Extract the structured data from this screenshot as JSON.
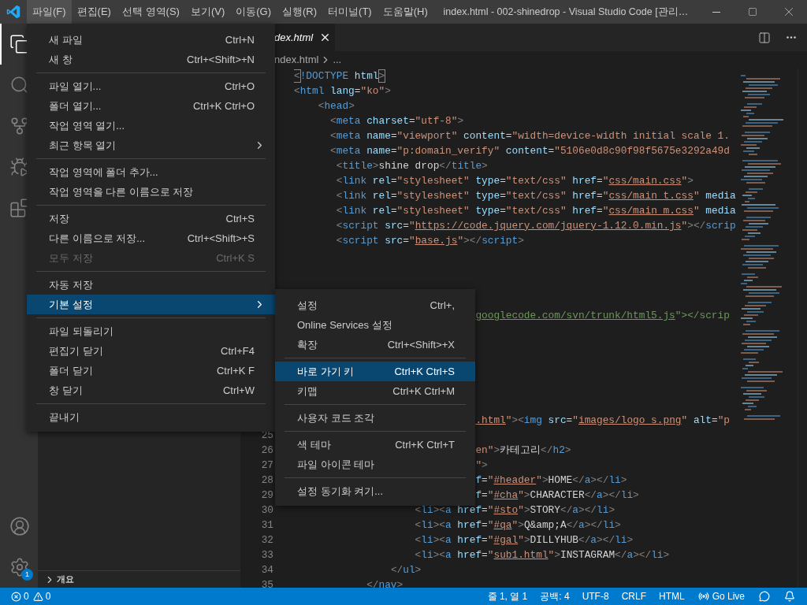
{
  "title_bar": {
    "menus": [
      {
        "label": "파일(F)",
        "selected": true
      },
      {
        "label": "편집(E)",
        "selected": false
      },
      {
        "label": "선택 영역(S)",
        "selected": false
      },
      {
        "label": "보기(V)",
        "selected": false
      },
      {
        "label": "이동(G)",
        "selected": false
      },
      {
        "label": "실행(R)",
        "selected": false
      },
      {
        "label": "터미널(T)",
        "selected": false
      },
      {
        "label": "도움말(H)",
        "selected": false
      }
    ],
    "title": "index.html - 002-shinedrop - Visual Studio Code [관리…"
  },
  "activity_bar": {
    "items": [
      {
        "kind": "files",
        "selected": true
      },
      {
        "kind": "search",
        "selected": false
      },
      {
        "kind": "source-control",
        "selected": false
      },
      {
        "kind": "run",
        "selected": false
      },
      {
        "kind": "extensions",
        "selected": false
      }
    ],
    "bottom": [
      {
        "kind": "account"
      },
      {
        "kind": "settings",
        "badge": "1"
      }
    ]
  },
  "sidebar": {
    "section": "개요"
  },
  "editor": {
    "tab": {
      "label": "dex.html"
    },
    "breadcrumb": {
      "file": "ndex.html",
      "more": "..."
    },
    "lines": [
      {
        "tokens": [
          {
            "kind": "match",
            "text": "<"
          },
          {
            "kind": "tag",
            "text": "!DOCTYPE"
          },
          {
            "kind": "attr",
            "text": " html"
          },
          {
            "kind": "match",
            "text": ">"
          }
        ]
      },
      {
        "tokens": [
          {
            "kind": "p",
            "text": "<"
          },
          {
            "kind": "tag",
            "text": "html"
          },
          {
            "kind": "attr",
            "text": " lang"
          },
          {
            "kind": "eq",
            "text": "="
          },
          {
            "kind": "str",
            "text": "\"ko\""
          },
          {
            "kind": "p",
            "text": ">"
          }
        ]
      },
      {
        "tokens": [
          {
            "kind": "p",
            "text": "    <"
          },
          {
            "kind": "tag",
            "text": "head"
          },
          {
            "kind": "p",
            "text": ">"
          }
        ]
      },
      {
        "tokens": [
          {
            "kind": "p",
            "text": "      <"
          },
          {
            "kind": "tag",
            "text": "meta"
          },
          {
            "kind": "attr",
            "text": " charset"
          },
          {
            "kind": "eq",
            "text": "="
          },
          {
            "kind": "str",
            "text": "\"utf-8\""
          },
          {
            "kind": "p",
            "text": ">"
          }
        ]
      },
      {
        "tokens": [
          {
            "kind": "p",
            "text": "      <"
          },
          {
            "kind": "tag",
            "text": "meta"
          },
          {
            "kind": "attr",
            "text": " name"
          },
          {
            "kind": "eq",
            "text": "="
          },
          {
            "kind": "str",
            "text": "\"viewport\""
          },
          {
            "kind": "attr",
            "text": " content"
          },
          {
            "kind": "eq",
            "text": "="
          },
          {
            "kind": "str",
            "text": "\"width=device-width initial scale 1."
          }
        ]
      },
      {
        "tokens": [
          {
            "kind": "p",
            "text": "      <"
          },
          {
            "kind": "tag",
            "text": "meta"
          },
          {
            "kind": "attr",
            "text": " name"
          },
          {
            "kind": "eq",
            "text": "="
          },
          {
            "kind": "str",
            "text": "\"p:domain_verify\""
          },
          {
            "kind": "attr",
            "text": " content"
          },
          {
            "kind": "eq",
            "text": "="
          },
          {
            "kind": "str",
            "text": "\"5106e0d8c90f98f5675e3292a49d"
          }
        ]
      },
      {
        "tokens": [
          {
            "kind": "p",
            "text": "       <"
          },
          {
            "kind": "tag",
            "text": "title"
          },
          {
            "kind": "p",
            "text": ">"
          },
          {
            "kind": "text",
            "text": "shine drop"
          },
          {
            "kind": "p",
            "text": "</"
          },
          {
            "kind": "tag",
            "text": "title"
          },
          {
            "kind": "p",
            "text": ">"
          }
        ]
      },
      {
        "tokens": [
          {
            "kind": "p",
            "text": "       <"
          },
          {
            "kind": "tag",
            "text": "link"
          },
          {
            "kind": "attr",
            "text": " rel"
          },
          {
            "kind": "eq",
            "text": "="
          },
          {
            "kind": "str",
            "text": "\"stylesheet\""
          },
          {
            "kind": "attr",
            "text": " type"
          },
          {
            "kind": "eq",
            "text": "="
          },
          {
            "kind": "str",
            "text": "\"text/css\""
          },
          {
            "kind": "attr",
            "text": " href"
          },
          {
            "kind": "eq",
            "text": "="
          },
          {
            "kind": "str",
            "text": "\""
          },
          {
            "kind": "link",
            "text": "css/main.css"
          },
          {
            "kind": "str",
            "text": "\""
          },
          {
            "kind": "p",
            "text": ">"
          }
        ]
      },
      {
        "tokens": [
          {
            "kind": "p",
            "text": "       <"
          },
          {
            "kind": "tag",
            "text": "link"
          },
          {
            "kind": "attr",
            "text": " rel"
          },
          {
            "kind": "eq",
            "text": "="
          },
          {
            "kind": "str",
            "text": "\"stylesheet\""
          },
          {
            "kind": "attr",
            "text": " type"
          },
          {
            "kind": "eq",
            "text": "="
          },
          {
            "kind": "str",
            "text": "\"text/css\""
          },
          {
            "kind": "attr",
            "text": " href"
          },
          {
            "kind": "eq",
            "text": "="
          },
          {
            "kind": "str",
            "text": "\""
          },
          {
            "kind": "link",
            "text": "css/main_t.css"
          },
          {
            "kind": "str",
            "text": "\""
          },
          {
            "kind": "attr",
            "text": " media"
          }
        ]
      },
      {
        "tokens": [
          {
            "kind": "p",
            "text": "       <"
          },
          {
            "kind": "tag",
            "text": "link"
          },
          {
            "kind": "attr",
            "text": " rel"
          },
          {
            "kind": "eq",
            "text": "="
          },
          {
            "kind": "str",
            "text": "\"stylesheet\""
          },
          {
            "kind": "attr",
            "text": " type"
          },
          {
            "kind": "eq",
            "text": "="
          },
          {
            "kind": "str",
            "text": "\"text/css\""
          },
          {
            "kind": "attr",
            "text": " href"
          },
          {
            "kind": "eq",
            "text": "="
          },
          {
            "kind": "str",
            "text": "\""
          },
          {
            "kind": "link",
            "text": "css/main_m.css"
          },
          {
            "kind": "str",
            "text": "\""
          },
          {
            "kind": "attr",
            "text": " media"
          }
        ]
      },
      {
        "tokens": [
          {
            "kind": "p",
            "text": "       <"
          },
          {
            "kind": "tag",
            "text": "script"
          },
          {
            "kind": "attr",
            "text": " src"
          },
          {
            "kind": "eq",
            "text": "="
          },
          {
            "kind": "str",
            "text": "\""
          },
          {
            "kind": "link",
            "text": "https://code.jquery.com/jquery-1.12.0.min.js"
          },
          {
            "kind": "str",
            "text": "\""
          },
          {
            "kind": "p",
            "text": "></"
          },
          {
            "kind": "tag",
            "text": "scrip"
          }
        ]
      },
      {
        "tokens": [
          {
            "kind": "p",
            "text": "       <"
          },
          {
            "kind": "tag",
            "text": "script"
          },
          {
            "kind": "attr",
            "text": " src"
          },
          {
            "kind": "eq",
            "text": "="
          },
          {
            "kind": "str",
            "text": "\""
          },
          {
            "kind": "link",
            "text": "base.js"
          },
          {
            "kind": "str",
            "text": "\""
          },
          {
            "kind": "p",
            "text": "></"
          },
          {
            "kind": "tag",
            "text": "script"
          },
          {
            "kind": "p",
            "text": ">"
          }
        ]
      },
      {
        "kind": "blank"
      },
      {
        "kind": "blank"
      },
      {
        "kind": "blank"
      },
      {
        "kind": "blank"
      },
      {
        "kind": "clipped",
        "tokens": [
          {
            "kind": "clink",
            "text": "googlecode.com/svn/trunk/html5.js"
          },
          {
            "kind": "comment",
            "text": "\"></scrip"
          }
        ]
      },
      {
        "kind": "blank"
      },
      {
        "kind": "blank"
      },
      {
        "kind": "blank"
      },
      {
        "kind": "blank"
      },
      {
        "kind": "blank"
      },
      {
        "kind": "blank"
      },
      {
        "kind": "clipped",
        "tokens": [
          {
            "kind": "link",
            "text": ".html"
          },
          {
            "kind": "str",
            "text": "\""
          },
          {
            "kind": "p",
            "text": "><"
          },
          {
            "kind": "tag",
            "text": "img"
          },
          {
            "kind": "attr",
            "text": " src"
          },
          {
            "kind": "eq",
            "text": "="
          },
          {
            "kind": "str",
            "text": "\""
          },
          {
            "kind": "link",
            "text": "images/logo_s.png"
          },
          {
            "kind": "str",
            "text": "\""
          },
          {
            "kind": "attr",
            "text": " alt"
          },
          {
            "kind": "eq",
            "text": "="
          },
          {
            "kind": "str",
            "text": "\"p"
          }
        ]
      },
      {
        "number": "25",
        "kind": "blank"
      },
      {
        "number": "26",
        "kind": "clipped",
        "tokens": [
          {
            "kind": "str",
            "text": "en\""
          },
          {
            "kind": "p",
            "text": ">"
          },
          {
            "kind": "text",
            "text": "카테고리"
          },
          {
            "kind": "p",
            "text": "</"
          },
          {
            "kind": "tag",
            "text": "h2"
          },
          {
            "kind": "p",
            "text": ">"
          }
        ]
      },
      {
        "number": "27",
        "kind": "clipped",
        "tokens": [
          {
            "kind": "str",
            "text": "\""
          },
          {
            "kind": "p",
            "text": ">"
          }
        ]
      },
      {
        "number": "28",
        "kind": "clipped",
        "tokens": [
          {
            "kind": "attr",
            "text": "f"
          },
          {
            "kind": "eq",
            "text": "="
          },
          {
            "kind": "str",
            "text": "\""
          },
          {
            "kind": "link",
            "text": "#header"
          },
          {
            "kind": "str",
            "text": "\""
          },
          {
            "kind": "p",
            "text": ">"
          },
          {
            "kind": "text",
            "text": "HOME"
          },
          {
            "kind": "p",
            "text": "</"
          },
          {
            "kind": "tag",
            "text": "a"
          },
          {
            "kind": "p",
            "text": "></"
          },
          {
            "kind": "tag",
            "text": "li"
          },
          {
            "kind": "p",
            "text": ">"
          }
        ]
      },
      {
        "number": "29",
        "kind": "clipped",
        "tokens": [
          {
            "kind": "attr",
            "text": "f"
          },
          {
            "kind": "eq",
            "text": "="
          },
          {
            "kind": "str",
            "text": "\""
          },
          {
            "kind": "link",
            "text": "#cha"
          },
          {
            "kind": "str",
            "text": "\""
          },
          {
            "kind": "p",
            "text": ">"
          },
          {
            "kind": "text",
            "text": "CHARACTER"
          },
          {
            "kind": "p",
            "text": "</"
          },
          {
            "kind": "tag",
            "text": "a"
          },
          {
            "kind": "p",
            "text": "></"
          },
          {
            "kind": "tag",
            "text": "li"
          },
          {
            "kind": "p",
            "text": ">"
          }
        ]
      },
      {
        "number": "30",
        "tokens": [
          {
            "kind": "p",
            "text": "                    <"
          },
          {
            "kind": "tag",
            "text": "li"
          },
          {
            "kind": "p",
            "text": "><"
          },
          {
            "kind": "tag",
            "text": "a"
          },
          {
            "kind": "attr",
            "text": " href"
          },
          {
            "kind": "eq",
            "text": "="
          },
          {
            "kind": "str",
            "text": "\""
          },
          {
            "kind": "link",
            "text": "#sto"
          },
          {
            "kind": "str",
            "text": "\""
          },
          {
            "kind": "p",
            "text": ">"
          },
          {
            "kind": "text",
            "text": "STORY"
          },
          {
            "kind": "p",
            "text": "</"
          },
          {
            "kind": "tag",
            "text": "a"
          },
          {
            "kind": "p",
            "text": "></"
          },
          {
            "kind": "tag",
            "text": "li"
          },
          {
            "kind": "p",
            "text": ">"
          }
        ]
      },
      {
        "number": "31",
        "tokens": [
          {
            "kind": "p",
            "text": "                    <"
          },
          {
            "kind": "tag",
            "text": "li"
          },
          {
            "kind": "p",
            "text": "><"
          },
          {
            "kind": "tag",
            "text": "a"
          },
          {
            "kind": "attr",
            "text": " href"
          },
          {
            "kind": "eq",
            "text": "="
          },
          {
            "kind": "str",
            "text": "\""
          },
          {
            "kind": "link",
            "text": "#qa"
          },
          {
            "kind": "str",
            "text": "\""
          },
          {
            "kind": "p",
            "text": ">"
          },
          {
            "kind": "text",
            "text": "Q&amp;A"
          },
          {
            "kind": "p",
            "text": "</"
          },
          {
            "kind": "tag",
            "text": "a"
          },
          {
            "kind": "p",
            "text": "></"
          },
          {
            "kind": "tag",
            "text": "li"
          },
          {
            "kind": "p",
            "text": ">"
          }
        ]
      },
      {
        "number": "32",
        "tokens": [
          {
            "kind": "p",
            "text": "                    <"
          },
          {
            "kind": "tag",
            "text": "li"
          },
          {
            "kind": "p",
            "text": "><"
          },
          {
            "kind": "tag",
            "text": "a"
          },
          {
            "kind": "attr",
            "text": " href"
          },
          {
            "kind": "eq",
            "text": "="
          },
          {
            "kind": "str",
            "text": "\""
          },
          {
            "kind": "link",
            "text": "#gal"
          },
          {
            "kind": "str",
            "text": "\""
          },
          {
            "kind": "p",
            "text": ">"
          },
          {
            "kind": "text",
            "text": "DILLYHUB"
          },
          {
            "kind": "p",
            "text": "</"
          },
          {
            "kind": "tag",
            "text": "a"
          },
          {
            "kind": "p",
            "text": "></"
          },
          {
            "kind": "tag",
            "text": "li"
          },
          {
            "kind": "p",
            "text": ">"
          }
        ]
      },
      {
        "number": "33",
        "tokens": [
          {
            "kind": "p",
            "text": "                    <"
          },
          {
            "kind": "tag",
            "text": "li"
          },
          {
            "kind": "p",
            "text": "><"
          },
          {
            "kind": "tag",
            "text": "a"
          },
          {
            "kind": "attr",
            "text": " href"
          },
          {
            "kind": "eq",
            "text": "="
          },
          {
            "kind": "str",
            "text": "\""
          },
          {
            "kind": "link",
            "text": "sub1.html"
          },
          {
            "kind": "str",
            "text": "\""
          },
          {
            "kind": "p",
            "text": ">"
          },
          {
            "kind": "text",
            "text": "INSTAGRAM"
          },
          {
            "kind": "p",
            "text": "</"
          },
          {
            "kind": "tag",
            "text": "a"
          },
          {
            "kind": "p",
            "text": "></"
          },
          {
            "kind": "tag",
            "text": "li"
          },
          {
            "kind": "p",
            "text": ">"
          }
        ]
      },
      {
        "number": "34",
        "tokens": [
          {
            "kind": "p",
            "text": "                </"
          },
          {
            "kind": "tag",
            "text": "ul"
          },
          {
            "kind": "p",
            "text": ">"
          }
        ]
      },
      {
        "number": "35",
        "tokens": [
          {
            "kind": "p",
            "text": "            </"
          },
          {
            "kind": "tag",
            "text": "nav"
          },
          {
            "kind": "p",
            "text": ">"
          }
        ]
      }
    ]
  },
  "file_menu": {
    "items": [
      {
        "kind": "item",
        "label": "새 파일",
        "shortcut": "Ctrl+N",
        "selected": false,
        "disabled": false
      },
      {
        "kind": "item",
        "label": "새 창",
        "shortcut": "Ctrl+<Shift>+N",
        "selected": false,
        "disabled": false
      },
      {
        "kind": "separator"
      },
      {
        "kind": "item",
        "label": "파일 열기...",
        "shortcut": "Ctrl+O",
        "selected": false,
        "disabled": false
      },
      {
        "kind": "item",
        "label": "폴더 열기...",
        "shortcut": "Ctrl+K Ctrl+O",
        "selected": false,
        "disabled": false
      },
      {
        "kind": "item",
        "label": "작업 영역 열기...",
        "selected": false,
        "disabled": false
      },
      {
        "kind": "item",
        "label": "최근 항목 열기",
        "submenu": true,
        "selected": false,
        "disabled": false
      },
      {
        "kind": "separator"
      },
      {
        "kind": "item",
        "label": "작업 영역에 폴더 추가...",
        "selected": false,
        "disabled": false
      },
      {
        "kind": "item",
        "label": "작업 영역을 다른 이름으로 저장",
        "selected": false,
        "disabled": false
      },
      {
        "kind": "separator"
      },
      {
        "kind": "item",
        "label": "저장",
        "shortcut": "Ctrl+S",
        "selected": false,
        "disabled": false
      },
      {
        "kind": "item",
        "label": "다른 이름으로 저장...",
        "shortcut": "Ctrl+<Shift>+S",
        "selected": false,
        "disabled": false
      },
      {
        "kind": "item",
        "label": "모두 저장",
        "shortcut": "Ctrl+K S",
        "selected": false,
        "disabled": true
      },
      {
        "kind": "separator"
      },
      {
        "kind": "item",
        "label": "자동 저장",
        "selected": false,
        "disabled": false
      },
      {
        "kind": "item",
        "label": "기본 설정",
        "submenu": true,
        "selected": true,
        "disabled": false
      },
      {
        "kind": "separator"
      },
      {
        "kind": "item",
        "label": "파일 되돌리기",
        "selected": false,
        "disabled": false
      },
      {
        "kind": "item",
        "label": "편집기 닫기",
        "shortcut": "Ctrl+F4",
        "selected": false,
        "disabled": false
      },
      {
        "kind": "item",
        "label": "폴더 닫기",
        "shortcut": "Ctrl+K F",
        "selected": false,
        "disabled": false
      },
      {
        "kind": "item",
        "label": "창 닫기",
        "shortcut": "Ctrl+W",
        "selected": false,
        "disabled": false
      },
      {
        "kind": "separator"
      },
      {
        "kind": "item",
        "label": "끝내기",
        "selected": false,
        "disabled": false
      }
    ]
  },
  "preferences_menu": {
    "items": [
      {
        "kind": "item",
        "label": "설정",
        "shortcut": "Ctrl+,",
        "selected": false,
        "disabled": false
      },
      {
        "kind": "item",
        "label": "Online Services 설정",
        "selected": false,
        "disabled": false
      },
      {
        "kind": "item",
        "label": "확장",
        "shortcut": "Ctrl+<Shift>+X",
        "selected": false,
        "disabled": false
      },
      {
        "kind": "separator"
      },
      {
        "kind": "item",
        "label": "바로 가기 키",
        "shortcut": "Ctrl+K Ctrl+S",
        "selected": true,
        "disabled": false
      },
      {
        "kind": "item",
        "label": "키맵",
        "shortcut": "Ctrl+K Ctrl+M",
        "selected": false,
        "disabled": false
      },
      {
        "kind": "separator"
      },
      {
        "kind": "item",
        "label": "사용자 코드 조각",
        "selected": false,
        "disabled": false
      },
      {
        "kind": "separator"
      },
      {
        "kind": "item",
        "label": "색 테마",
        "shortcut": "Ctrl+K Ctrl+T",
        "selected": false,
        "disabled": false
      },
      {
        "kind": "item",
        "label": "파일 아이콘 테마",
        "selected": false,
        "disabled": false
      },
      {
        "kind": "separator"
      },
      {
        "kind": "item",
        "label": "설정 동기화 켜기...",
        "selected": false,
        "disabled": false
      }
    ]
  },
  "status_bar": {
    "errors": "0",
    "warnings": "0",
    "items": [
      {
        "kind": "text",
        "label": "줄 1, 열 1"
      },
      {
        "kind": "text",
        "label": "공백: 4"
      },
      {
        "kind": "text",
        "label": "UTF-8"
      },
      {
        "kind": "text",
        "label": "CRLF"
      },
      {
        "kind": "text",
        "label": "HTML"
      },
      {
        "kind": "go-live",
        "label": "Go Live"
      },
      {
        "kind": "feedback"
      },
      {
        "kind": "bell"
      }
    ]
  }
}
